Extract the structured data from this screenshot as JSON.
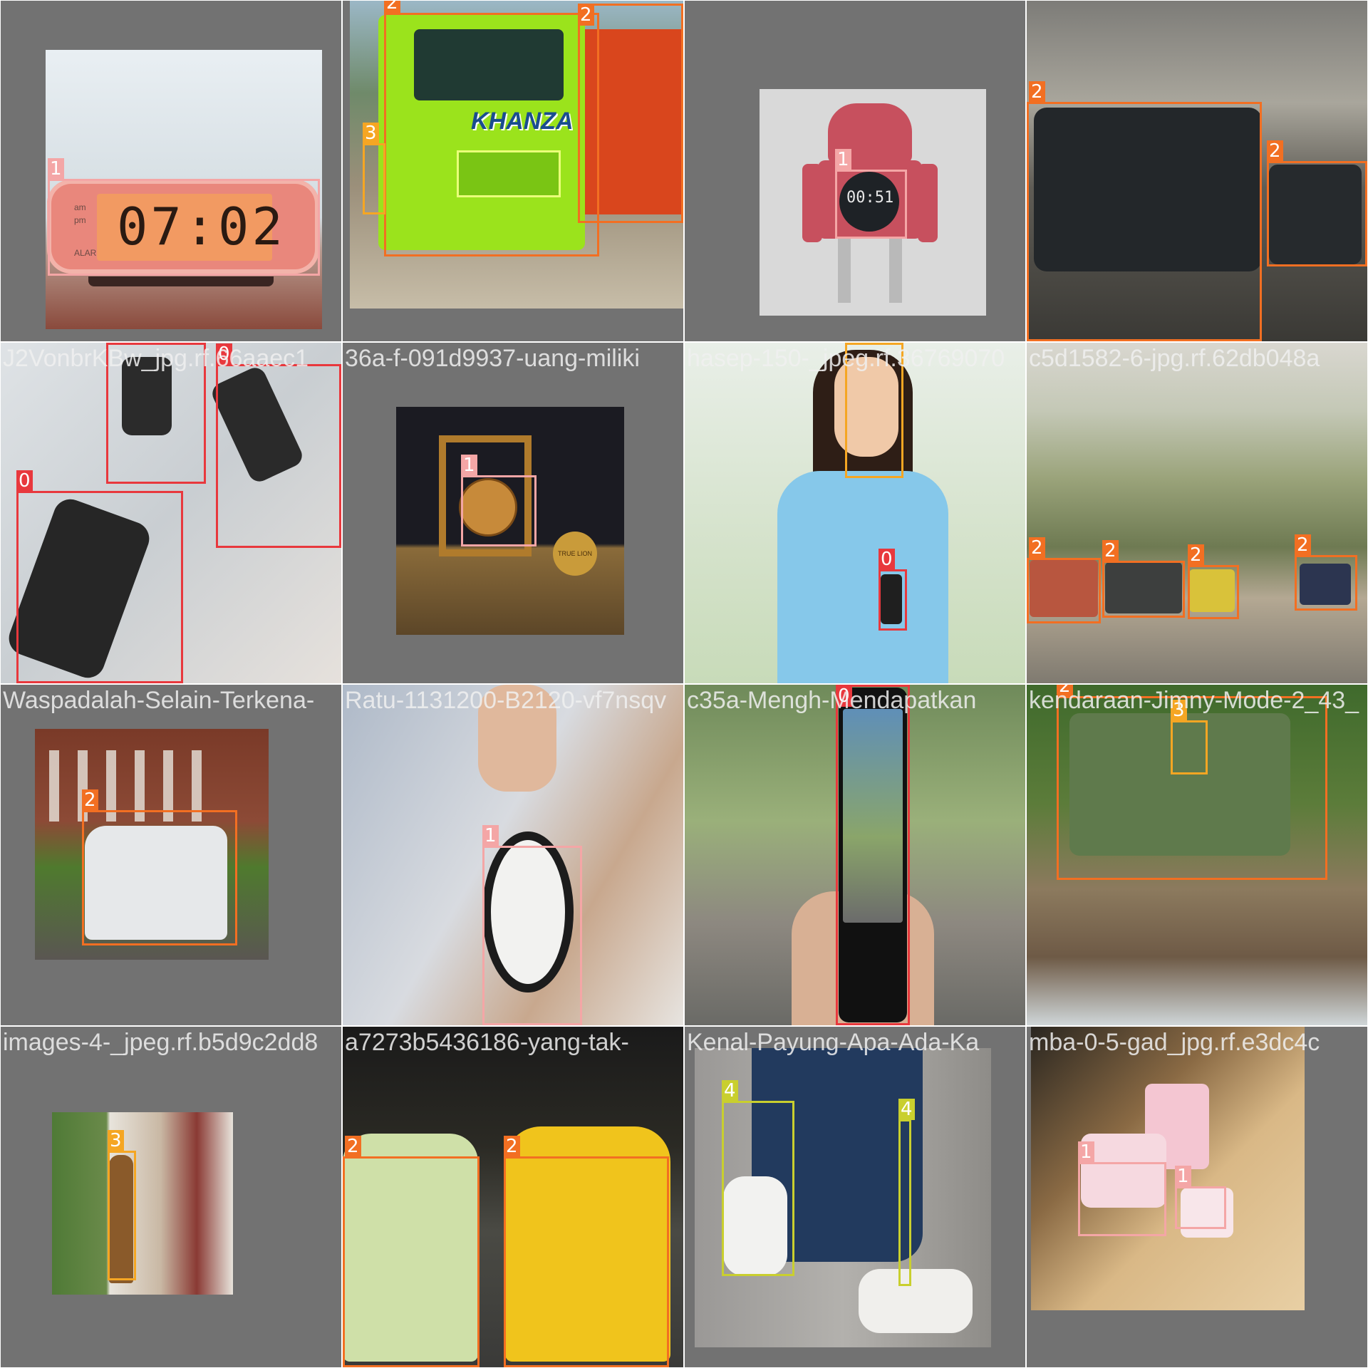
{
  "class_colors": {
    "0": "#e8383d",
    "1": "#f4a6a6",
    "2": "#f26f22",
    "3": "#f5a623",
    "4": "#c9cf2e"
  },
  "tiles": [
    {
      "filename": "",
      "scene": "alarm-clock-display",
      "display_text": "07:02",
      "display_sublabels": [
        "am",
        "pm",
        "ALARM"
      ],
      "boxes": [
        {
          "cls": "1"
        }
      ]
    },
    {
      "filename": "",
      "scene": "green-truck",
      "truck_lettering": "KHANZA",
      "boxes": [
        {
          "cls": "2"
        },
        {
          "cls": "2"
        },
        {
          "cls": "3"
        }
      ]
    },
    {
      "filename": "",
      "scene": "robot-clock",
      "display_text": "00:51",
      "boxes": [
        {
          "cls": "1"
        }
      ]
    },
    {
      "filename": "",
      "scene": "dark-jeeps",
      "boxes": [
        {
          "cls": "2"
        },
        {
          "cls": "2"
        }
      ]
    },
    {
      "filename": "J2VonbrKBw_jpg.rf.66aaec1",
      "scene": "phones-in-hands",
      "boxes": [
        {
          "cls": "0"
        },
        {
          "cls": "0"
        },
        {
          "cls": "0"
        }
      ]
    },
    {
      "filename": "36a-f-091d9937-uang-miliki",
      "scene": "wooden-clock",
      "badge_text": "TRUE LION",
      "boxes": [
        {
          "cls": "1"
        }
      ]
    },
    {
      "filename": "hasep-150-_jpeg.rf.36769070",
      "scene": "woman-with-phone",
      "boxes": [
        {
          "cls": "3"
        },
        {
          "cls": "0"
        }
      ]
    },
    {
      "filename": "c5d1582-6-jpg.rf.62db048a",
      "scene": "jeep-convoy",
      "boxes": [
        {
          "cls": "2"
        },
        {
          "cls": "2"
        },
        {
          "cls": "2"
        },
        {
          "cls": "2"
        }
      ]
    },
    {
      "filename": "Waspadalah-Selain-Terkena-",
      "scene": "white-van",
      "boxes": [
        {
          "cls": "2"
        }
      ]
    },
    {
      "filename": "Ratu-1131200-B2120-vf7nsqv",
      "scene": "hand-on-alarm-clock",
      "boxes": [
        {
          "cls": "1"
        }
      ]
    },
    {
      "filename": "c35a-Mengh-Mendapatkan",
      "scene": "phone-camera",
      "boxes": [
        {
          "cls": "0"
        }
      ]
    },
    {
      "filename": "kendaraan-Jimny-Mode-2_43_",
      "scene": "green-jeep-rocks",
      "boxes": [
        {
          "cls": "2"
        },
        {
          "cls": "3"
        }
      ]
    },
    {
      "filename": "images-4-_jpeg.rf.b5d9c2dd8",
      "scene": "man-at-door",
      "boxes": [
        {
          "cls": "3"
        }
      ]
    },
    {
      "filename": "a7273b5436186-yang-tak-",
      "scene": "city-cars",
      "boxes": [
        {
          "cls": "2"
        },
        {
          "cls": "2"
        }
      ]
    },
    {
      "filename": "Kenal-Payung-Apa-Ada-Ka",
      "scene": "sneakers",
      "boxes": [
        {
          "cls": "4"
        },
        {
          "cls": "4"
        }
      ]
    },
    {
      "filename": "mba-0-5-gad_jpg.rf.e3dc4c",
      "scene": "pink-clocks",
      "boxes": [
        {
          "cls": "1"
        },
        {
          "cls": "1"
        }
      ]
    }
  ]
}
